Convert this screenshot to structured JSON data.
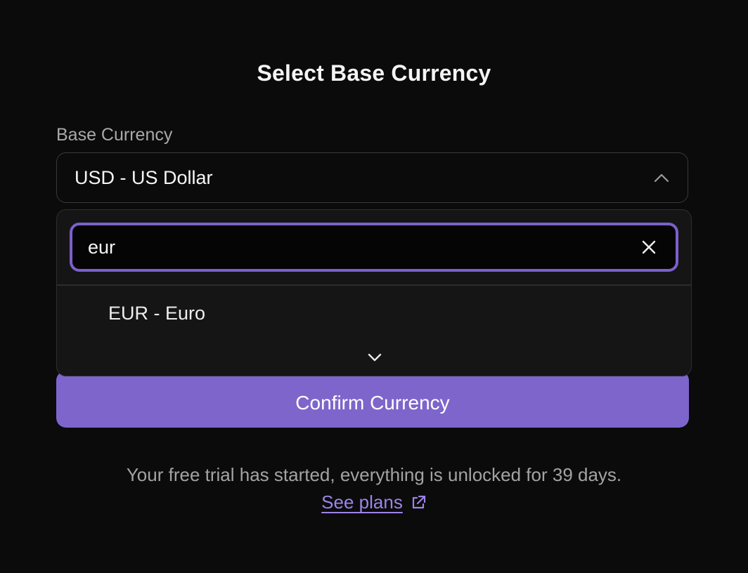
{
  "dialog": {
    "title": "Select Base Currency"
  },
  "base_currency": {
    "label": "Base Currency",
    "selected_value": "USD - US Dollar",
    "expanded": true
  },
  "dropdown": {
    "search_value": "eur",
    "options": [
      {
        "label": "EUR - Euro"
      }
    ]
  },
  "confirm_button": {
    "label": "Confirm Currency"
  },
  "footer": {
    "trial_text": "Your free trial has started, everything is unlocked for 39 days.",
    "plans_link": "See plans"
  },
  "icons": {
    "select_toggle": "chevron-up-icon",
    "clear_search": "close-icon",
    "scroll_more": "chevron-down-icon",
    "plans_link": "external-link-icon"
  },
  "colors": {
    "background": "#0b0b0b",
    "accent": "#7e65cb",
    "focus_ring": "#7c5fcb",
    "link": "#9c84ea",
    "dropdown_bg": "#151515"
  }
}
